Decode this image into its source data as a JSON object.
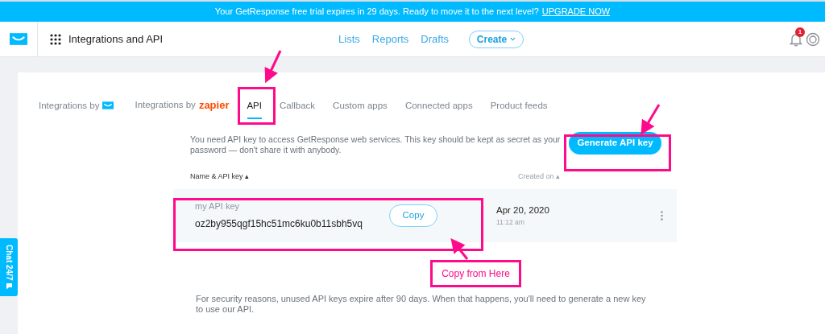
{
  "banner": {
    "text": "Your GetResponse free trial expires in 29 days. Ready to move it to the next level?",
    "link": "UPGRADE NOW"
  },
  "header": {
    "title": "Integrations and API",
    "nav": [
      "Lists",
      "Reports",
      "Drafts"
    ],
    "create_button": "Create",
    "notification_count": "1"
  },
  "tabs": [
    {
      "label": "Integrations by",
      "kind": "envelope-logo",
      "selected": false
    },
    {
      "label": "Integrations by",
      "kind": "text-logo",
      "logo_text": "zapier",
      "selected": false
    },
    {
      "label": "API",
      "selected": true
    },
    {
      "label": "Callback",
      "selected": false
    },
    {
      "label": "Custom apps",
      "selected": false
    },
    {
      "label": "Connected apps",
      "selected": false
    },
    {
      "label": "Product feeds",
      "selected": false
    }
  ],
  "intro": "You need API key to access GetResponse web services. This key should be kept as secret as your password — don't share it with anybody.",
  "generate_button": "Generate API key",
  "table": {
    "columns": [
      {
        "label": "Name & API key",
        "sort_mark": "▴"
      },
      {
        "label": "Created on",
        "sort_mark": "▴"
      }
    ],
    "rows": [
      {
        "name": "my API key",
        "key": "oz2by955qgf15hc51mc6ku0b11sbh5vq",
        "copy_button": "Copy",
        "date": "Apr 20, 2020",
        "time": "11:12 am"
      }
    ]
  },
  "footer_note": "For security reasons, unused API keys expire after 90 days. When that happens, you'll need to generate a new key to use our API.",
  "chat_tab": "Chat 24/7",
  "annotation": {
    "callout": "Copy from Here"
  }
}
